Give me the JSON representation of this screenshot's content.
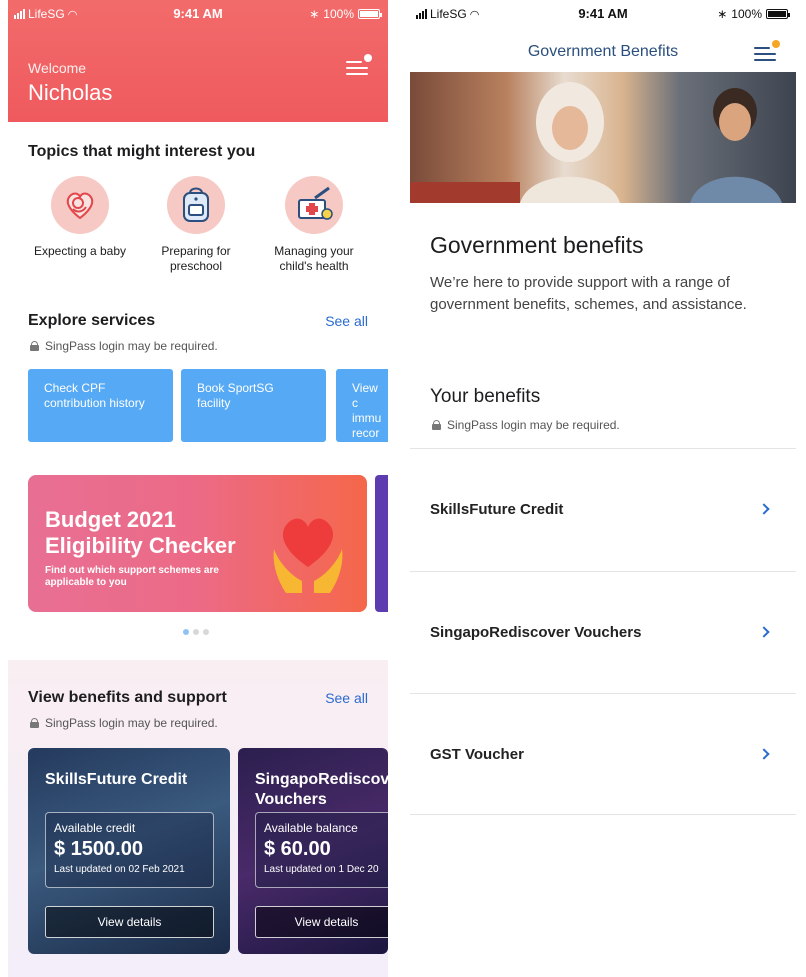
{
  "left": {
    "status": {
      "carrier": "LifeSG",
      "time": "9:41 AM",
      "battery": "100%"
    },
    "header": {
      "welcome": "Welcome",
      "name": "Nicholas"
    },
    "topics": {
      "title": "Topics that might interest you",
      "items": [
        {
          "label": "Expecting a baby",
          "icon": "baby-icon"
        },
        {
          "label": "Preparing for preschool",
          "icon": "backpack-icon"
        },
        {
          "label": "Managing your child's health",
          "icon": "health-icon"
        }
      ]
    },
    "services": {
      "title": "Explore services",
      "see_all": "See all",
      "note": "SingPass login may be required.",
      "items": [
        "Check CPF contribution history",
        "Book SportSG facility",
        "View c immu recor"
      ]
    },
    "banner": {
      "title_line1": "Budget 2021",
      "title_line2": "Eligibility Checker",
      "subtitle": "Find out which support schemes are applicable to you",
      "pages": 3,
      "active_page": 1
    },
    "benefits": {
      "title": "View benefits and support",
      "see_all": "See all",
      "note": "SingPass login may be required.",
      "cards": [
        {
          "title": "SkillsFuture Credit",
          "label": "Available credit",
          "amount": "$ 1500.00",
          "updated": "Last updated on 02 Feb 2021",
          "button": "View details"
        },
        {
          "title": "SingapoRediscov Vouchers",
          "label": "Available balance",
          "amount": "$ 60.00",
          "updated": "Last updated on 1 Dec 20",
          "button": "View details"
        }
      ]
    }
  },
  "right": {
    "status": {
      "carrier": "LifeSG",
      "time": "9:41 AM",
      "battery": "100%"
    },
    "nav_title": "Government Benefits",
    "heading": "Government benefits",
    "description": "We’re here to provide support with a range of government benefits, schemes, and assistance.",
    "your_benefits": "Your benefits",
    "note": "SingPass login may be required.",
    "list": [
      "SkillsFuture Credit",
      "SingapoRediscover Vouchers",
      "GST Voucher"
    ]
  },
  "colors": {
    "header_red": "#ef5a5e",
    "link_blue": "#2a6bcf",
    "service_blue": "#56a9f4",
    "notification_orange": "#f5a623",
    "nav_title": "#2b4f7e"
  }
}
